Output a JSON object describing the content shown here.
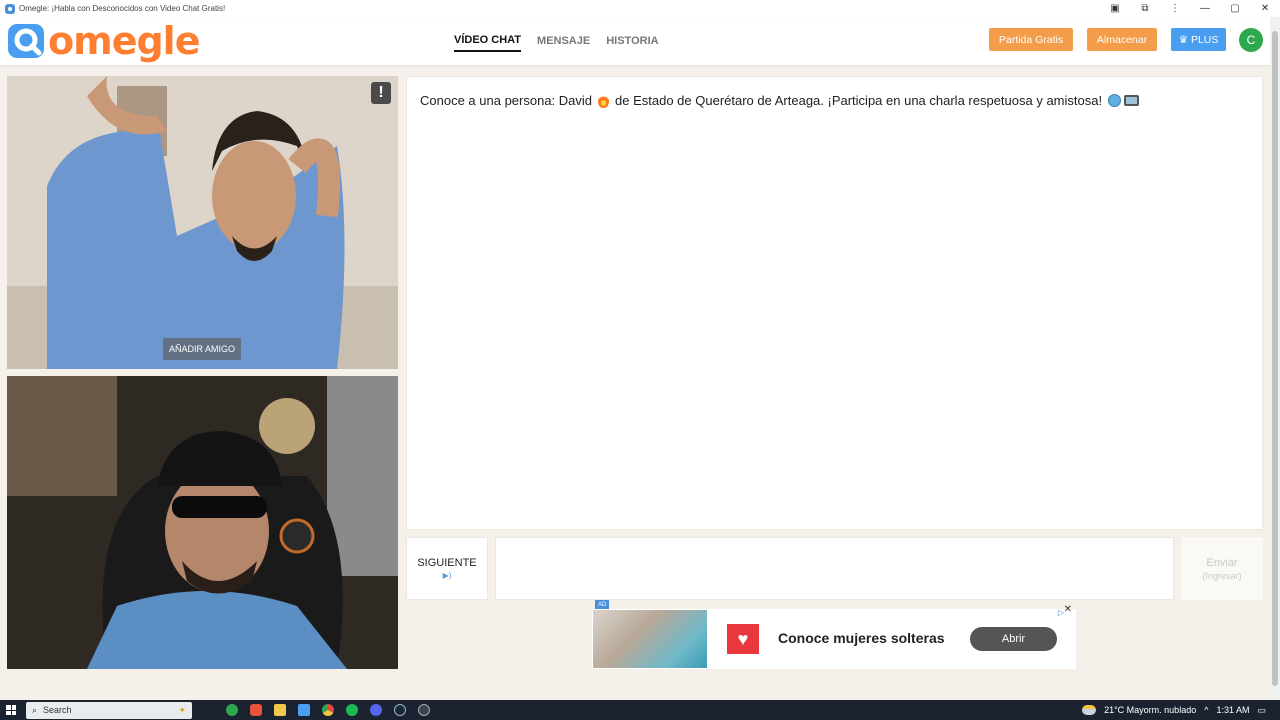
{
  "window": {
    "title": "Omegle: ¡Habla con Desconocidos con Video Chat Gratis!",
    "controls": [
      "—",
      "▢",
      "✕"
    ]
  },
  "header": {
    "logo_text": "omegle",
    "nav": [
      "VÍDEO CHAT",
      "MENSAJE",
      "HISTORIA"
    ],
    "buttons": {
      "partida": "Partida Gratis",
      "almacenar": "Almacenar",
      "plus": "♛ PLUS"
    },
    "avatar_initial": "C"
  },
  "video": {
    "report_label": "!",
    "add_friend": "AÑADIR AMIGO"
  },
  "chat": {
    "message_part1": "Conoce a una persona: David",
    "message_part2": "de Estado de Querétaro de Arteaga. ¡Participa en una charla respetuosa y amistosa!",
    "next_button": "SIGUIENTE",
    "next_hint": "▶)",
    "send_button": "Enviar",
    "send_hint": "(Ingresar)",
    "input_placeholder": ""
  },
  "ad": {
    "tag": "AD",
    "text": "Conoce mujeres solteras",
    "button": "Abrir",
    "close": "✕",
    "choices": "▷"
  },
  "taskbar": {
    "search_placeholder": "Search",
    "weather": "21°C  Mayorm. nublado",
    "time": "1:31 AM",
    "tray_arrow": "^",
    "notification": "▭"
  },
  "colors": {
    "brand_orange": "#ff7f32",
    "button_orange": "#f39c4a",
    "button_blue": "#4a9ef0",
    "avatar_green": "#2ea84c",
    "ad_red": "#e8383d"
  }
}
